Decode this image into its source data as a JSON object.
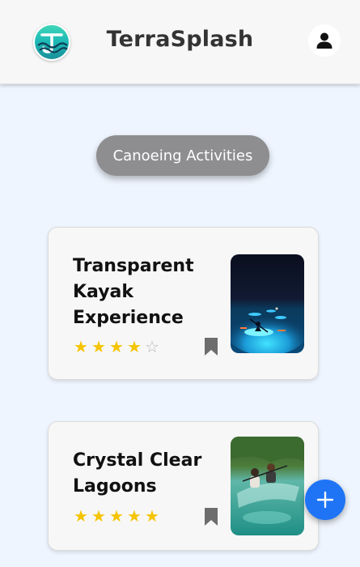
{
  "header": {
    "app_title": "TerraSplash",
    "logo_icon": "terrasplash-logo",
    "profile_icon": "user-icon"
  },
  "category": {
    "label": "Canoeing Activities"
  },
  "activities": [
    {
      "title": "Transparent Kayak Experience",
      "rating": 4,
      "max_rating": 5,
      "bookmark_icon": "bookmark-icon",
      "image_description_icon": "night-kayak-photo"
    },
    {
      "title": "Crystal Clear Lagoons",
      "rating": 5,
      "max_rating": 5,
      "bookmark_icon": "bookmark-icon",
      "image_description_icon": "lagoon-kayak-photo"
    }
  ],
  "fab": {
    "icon": "plus-icon"
  },
  "colors": {
    "background": "#eef5fe",
    "header": "#f7f7f7",
    "pill": "#8e8d90",
    "star": "#f5c400",
    "fab": "#1e74f5"
  }
}
